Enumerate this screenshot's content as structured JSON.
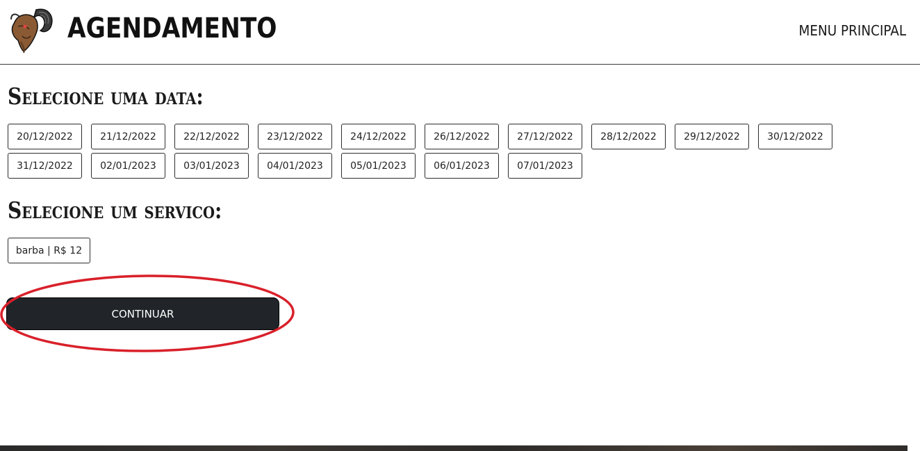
{
  "header": {
    "brand_title": "AGENDAMENTO",
    "logo_icon": "ram-head-logo-icon",
    "menu_label": "MENU PRINCIPAL"
  },
  "dates_section": {
    "title": "Selecione uma data:",
    "dates": [
      "20/12/2022",
      "21/12/2022",
      "22/12/2022",
      "23/12/2022",
      "24/12/2022",
      "26/12/2022",
      "27/12/2022",
      "28/12/2022",
      "29/12/2022",
      "30/12/2022",
      "31/12/2022",
      "02/01/2023",
      "03/01/2023",
      "04/01/2023",
      "05/01/2023",
      "06/01/2023",
      "07/01/2023"
    ]
  },
  "services_section": {
    "title": "Selecione um servico:",
    "services": [
      "barba | R$ 12"
    ]
  },
  "actions": {
    "continue_label": "CONTINUAR"
  },
  "colors": {
    "button_dark": "#212529",
    "highlight_red": "#d9202a",
    "border": "#2d2d2d"
  }
}
